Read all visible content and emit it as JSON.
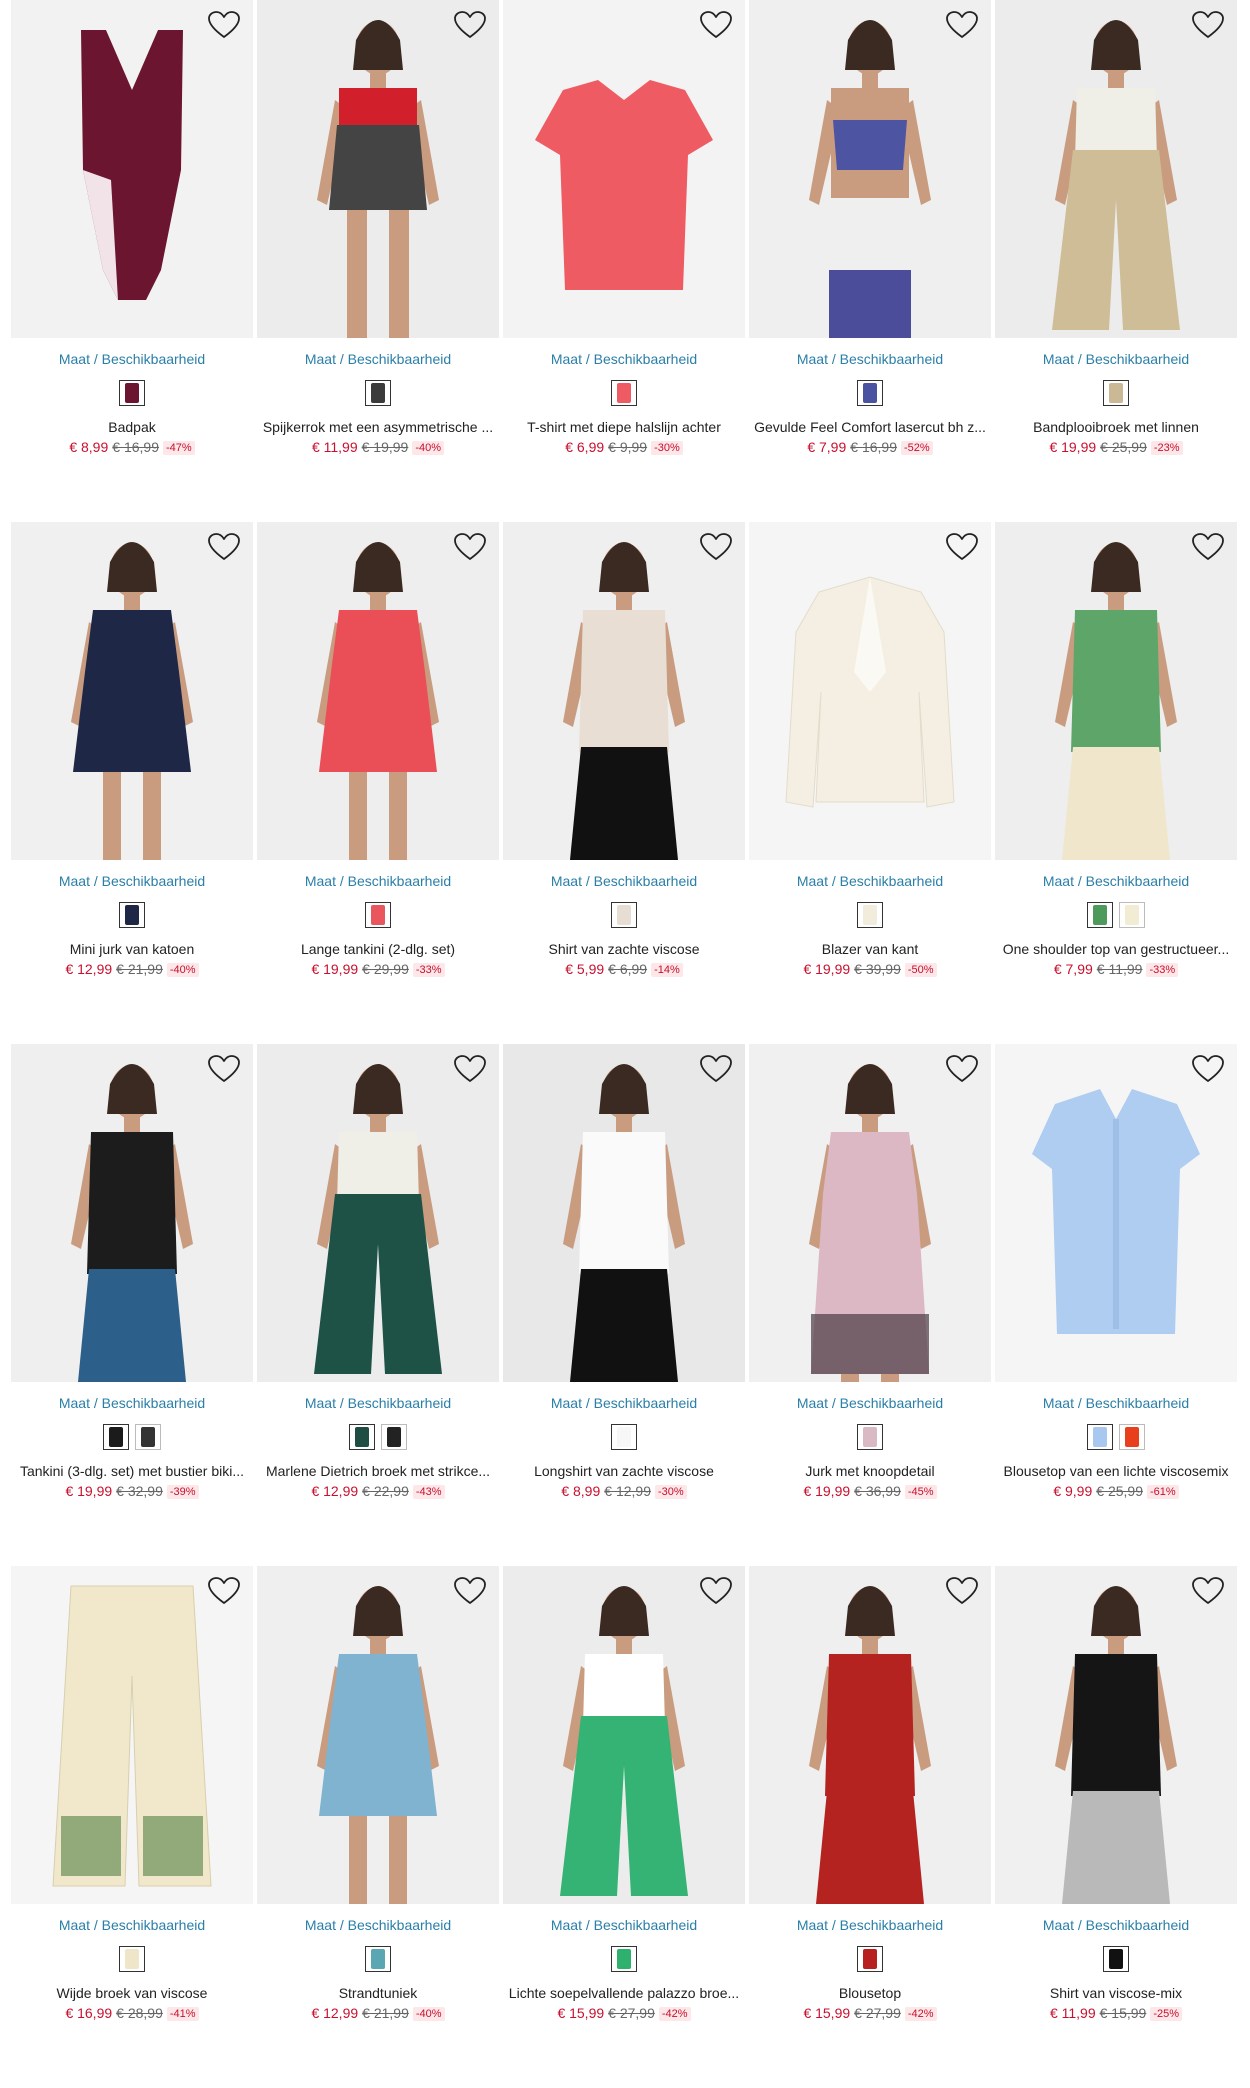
{
  "labels": {
    "availability": "Maat / Beschikbaarheid"
  },
  "colors": {
    "price_sale": "#c8102e",
    "link": "#2a7fa8",
    "discount_bg": "#fde7e9"
  },
  "products": [
    {
      "name": "Badpak",
      "price": "€ 8,99",
      "old_price": "€ 16,99",
      "discount": "-47%",
      "swatches": [
        "#6b1530"
      ],
      "image": "burgundy-swimsuit",
      "garment": "#6b1530",
      "bg": "#f2f2f2"
    },
    {
      "name": "Spijkerrok met een asymmetrische ...",
      "price": "€ 11,99",
      "old_price": "€ 19,99",
      "discount": "-40%",
      "swatches": [
        "#3b3b3b"
      ],
      "image": "grey-denim-skirt",
      "garment": "#444444",
      "bg": "#ececec"
    },
    {
      "name": "T-shirt met diepe halslijn achter",
      "price": "€ 6,99",
      "old_price": "€ 9,99",
      "discount": "-30%",
      "swatches": [
        "#ef5b63"
      ],
      "image": "coral-tshirt",
      "garment": "#ef5b63",
      "bg": "#f3f3f3"
    },
    {
      "name": "Gevulde Feel Comfort lasercut bh z...",
      "price": "€ 7,99",
      "old_price": "€ 16,99",
      "discount": "-52%",
      "swatches": [
        "#4a53a0"
      ],
      "image": "blue-bra",
      "garment": "#4d55a2",
      "bg": "#efefef"
    },
    {
      "name": "Bandplooibroek met linnen",
      "price": "€ 19,99",
      "old_price": "€ 25,99",
      "discount": "-23%",
      "swatches": [
        "#cbb894"
      ],
      "image": "beige-trousers",
      "garment": "#cfbd98",
      "bg": "#ececec"
    },
    {
      "name": "Mini jurk van katoen",
      "price": "€ 12,99",
      "old_price": "€ 21,99",
      "discount": "-40%",
      "swatches": [
        "#1f2747"
      ],
      "image": "navy-dress",
      "garment": "#1f2747",
      "bg": "#f0f0f0"
    },
    {
      "name": "Lange tankini (2-dlg. set)",
      "price": "€ 19,99",
      "old_price": "€ 29,99",
      "discount": "-33%",
      "swatches": [
        "#e9565e"
      ],
      "image": "floral-tankini",
      "garment": "#ea4f57",
      "bg": "#eeeeee"
    },
    {
      "name": "Shirt van zachte viscose",
      "price": "€ 5,99",
      "old_price": "€ 6,99",
      "discount": "-14%",
      "swatches": [
        "#e8ddd2"
      ],
      "image": "beige-shirt",
      "garment": "#e9ded3",
      "bg": "#efefef"
    },
    {
      "name": "Blazer van kant",
      "price": "€ 19,99",
      "old_price": "€ 39,99",
      "discount": "-50%",
      "swatches": [
        "#f2ecdc"
      ],
      "image": "lace-blazer",
      "garment": "#f4efe2",
      "bg": "#f5f5f5"
    },
    {
      "name": "One shoulder top van gestructueer...",
      "price": "€ 7,99",
      "old_price": "€ 11,99",
      "discount": "-33%",
      "swatches": [
        "#4d9a5a",
        "#f2ecd4"
      ],
      "image": "green-top",
      "garment": "#5ea56a",
      "bg": "#eeeeee"
    },
    {
      "name": "Tankini (3-dlg. set) met bustier biki...",
      "price": "€ 19,99",
      "old_price": "€ 32,99",
      "discount": "-39%",
      "swatches": [
        "#1b1b1b",
        "#333"
      ],
      "image": "black-tankini",
      "garment": "#1c1c1c",
      "bg": "#efefef"
    },
    {
      "name": "Marlene Dietrich broek met strikce...",
      "price": "€ 12,99",
      "old_price": "€ 22,99",
      "discount": "-43%",
      "swatches": [
        "#1f4d43",
        "#222"
      ],
      "image": "letter-print-pants",
      "garment": "#1e5246",
      "bg": "#ececec"
    },
    {
      "name": "Longshirt van zachte viscose",
      "price": "€ 8,99",
      "old_price": "€ 12,99",
      "discount": "-30%",
      "swatches": [
        "#f7f7f7"
      ],
      "image": "white-longshirt",
      "garment": "#fafafa",
      "bg": "#e8e8e8"
    },
    {
      "name": "Jurk met knoopdetail",
      "price": "€ 19,99",
      "old_price": "€ 36,99",
      "discount": "-45%",
      "swatches": [
        "#d9b9c3"
      ],
      "image": "ombre-maxi-dress",
      "garment": "#dcb8c4",
      "bg": "#f0f0f0"
    },
    {
      "name": "Blousetop van een lichte viscosemix",
      "price": "€ 9,99",
      "old_price": "€ 25,99",
      "discount": "-61%",
      "swatches": [
        "#a9c8ef",
        "#e8401c"
      ],
      "image": "lightblue-blouse",
      "garment": "#afcdf0",
      "bg": "#f5f5f5"
    },
    {
      "name": "Wijde broek van viscose",
      "price": "€ 16,99",
      "old_price": "€ 28,99",
      "discount": "-41%",
      "swatches": [
        "#efe6c9"
      ],
      "image": "printed-wide-pants",
      "garment": "#f1e8cc",
      "bg": "#f5f5f5"
    },
    {
      "name": "Strandtuniek",
      "price": "€ 12,99",
      "old_price": "€ 21,99",
      "discount": "-40%",
      "swatches": [
        "#5aa6b3"
      ],
      "image": "beach-tunic",
      "garment": "#7fb3cf",
      "bg": "#efefef"
    },
    {
      "name": "Lichte soepelvallende palazzo broe...",
      "price": "€ 15,99",
      "old_price": "€ 27,99",
      "discount": "-42%",
      "swatches": [
        "#2eb06e"
      ],
      "image": "green-palazzo",
      "garment": "#35b374",
      "bg": "#ececec"
    },
    {
      "name": "Blousetop",
      "price": "€ 15,99",
      "old_price": "€ 27,99",
      "discount": "-42%",
      "swatches": [
        "#b8201f"
      ],
      "image": "red-blousetop",
      "garment": "#b52320",
      "bg": "#efefef"
    },
    {
      "name": "Shirt van viscose-mix",
      "price": "€ 11,99",
      "old_price": "€ 15,99",
      "discount": "-25%",
      "swatches": [
        "#111111"
      ],
      "image": "black-shirt",
      "garment": "#151515",
      "bg": "#f0f0f0"
    }
  ]
}
